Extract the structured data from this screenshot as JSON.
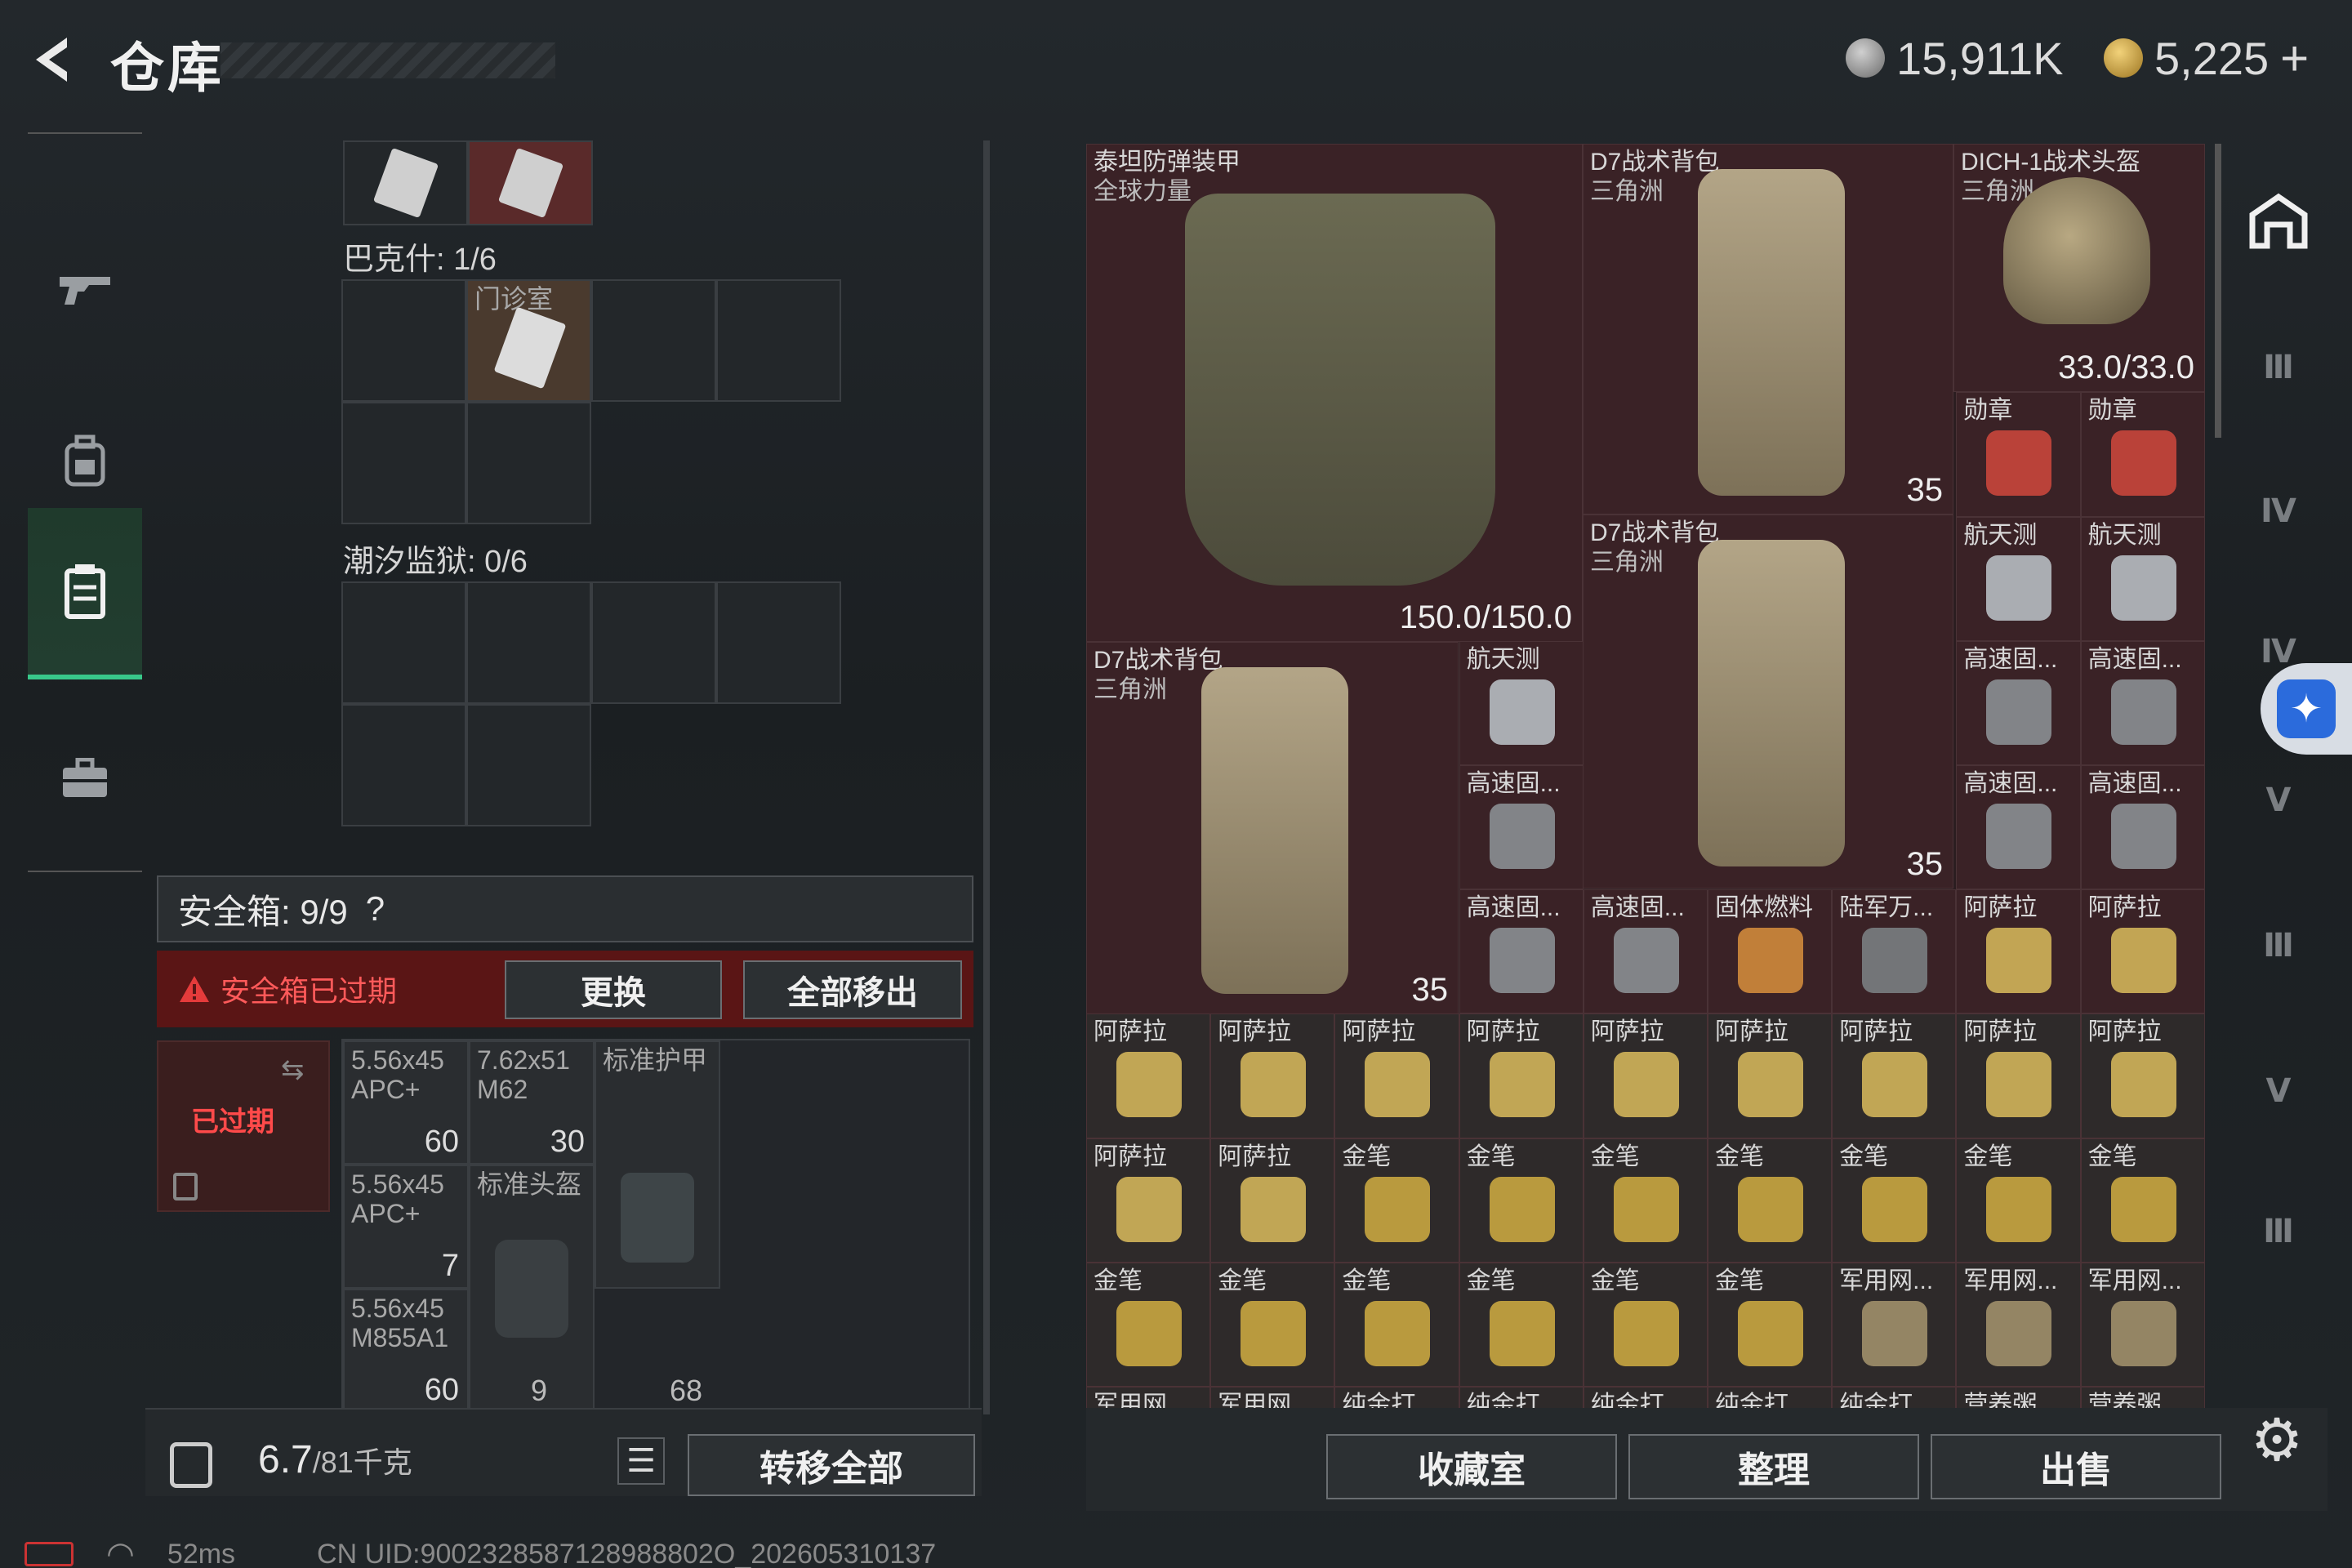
{
  "header": {
    "title": "仓库",
    "currency1": "15,911K",
    "currency2": "5,225",
    "plus": "+"
  },
  "left_panel": {
    "bakesh_label": "巴克什: 1/6",
    "clinic_item": "门诊室",
    "tide_label": "潮汐监狱: 0/6",
    "safebox_label": "安全箱: 9/9",
    "help": "?",
    "expired_warning": "安全箱已过期",
    "replace_btn": "更换",
    "remove_all_btn": "全部移出",
    "expired_badge": "已过期",
    "items": [
      {
        "name": "5.56x45 APC+",
        "count": "60"
      },
      {
        "name": "7.62x51 M62",
        "count": "30"
      },
      {
        "name": "标准护甲",
        "count": ""
      },
      {
        "name": "5.56x45 APC+",
        "count": "7"
      },
      {
        "name": "标准头盔",
        "count": ""
      },
      {
        "name": "5.56x45 M855A1",
        "count": "60"
      }
    ],
    "stat1": "9",
    "stat2": "68",
    "weight_value": "6.7",
    "weight_total": "/81千克",
    "transfer_all_btn": "转移全部"
  },
  "inventory": {
    "armor": {
      "name": "泰坦防弹装甲",
      "sub": "全球力量",
      "durability": "150.0/150.0"
    },
    "backpacks": [
      {
        "name": "D7战术背包",
        "sub": "三角洲",
        "count": "35"
      },
      {
        "name": "D7战术背包",
        "sub": "三角洲",
        "count": "35"
      },
      {
        "name": "D7战术背包",
        "sub": "三角洲",
        "count": "35"
      }
    ],
    "helmet": {
      "name": "DICH-1战术头盔",
      "sub": "三角洲",
      "durability": "33.0/33.0"
    },
    "small_items": [
      "勋章",
      "勋章",
      "航天测",
      "航天测",
      "航天测",
      "高速固...",
      "高速固...",
      "高速固...",
      "高速固...",
      "高速固...",
      "高速固...",
      "高速固...",
      "固体燃料",
      "陆军万...",
      "阿萨拉",
      "阿萨拉",
      "阿萨拉",
      "阿萨拉",
      "阿萨拉",
      "阿萨拉",
      "阿萨拉",
      "阿萨拉",
      "阿萨拉",
      "阿萨拉",
      "阿萨拉",
      "阿萨拉",
      "阿萨拉",
      "金笔",
      "金笔",
      "金笔",
      "金笔",
      "金笔",
      "金笔",
      "金笔",
      "金笔",
      "金笔",
      "金笔",
      "金笔",
      "金笔",
      "金笔",
      "军用网...",
      "军用网...",
      "军用网...",
      "军用网...",
      "军用网...",
      "纯金打...",
      "纯金打...",
      "纯金打...",
      "纯金打...",
      "纯金打...",
      "营养粥...",
      "营养粥..."
    ]
  },
  "bottom": {
    "collection_btn": "收藏室",
    "sort_btn": "整理",
    "sell_btn": "出售"
  },
  "status": {
    "ping": "52ms",
    "uid": "CN UID:9002328587128988802O_202605310137"
  },
  "colors": {
    "accent_green": "#38c98a",
    "expired_red": "#5a1515",
    "inventory_bg": "#3a2226"
  },
  "icons": {
    "back": "back-arrow-icon",
    "gun": "gun-icon",
    "backpack": "backpack-icon",
    "safebox": "safebox-icon",
    "briefcase": "briefcase-icon",
    "settings": "gear-icon",
    "accessibility": "accessibility-icon"
  }
}
